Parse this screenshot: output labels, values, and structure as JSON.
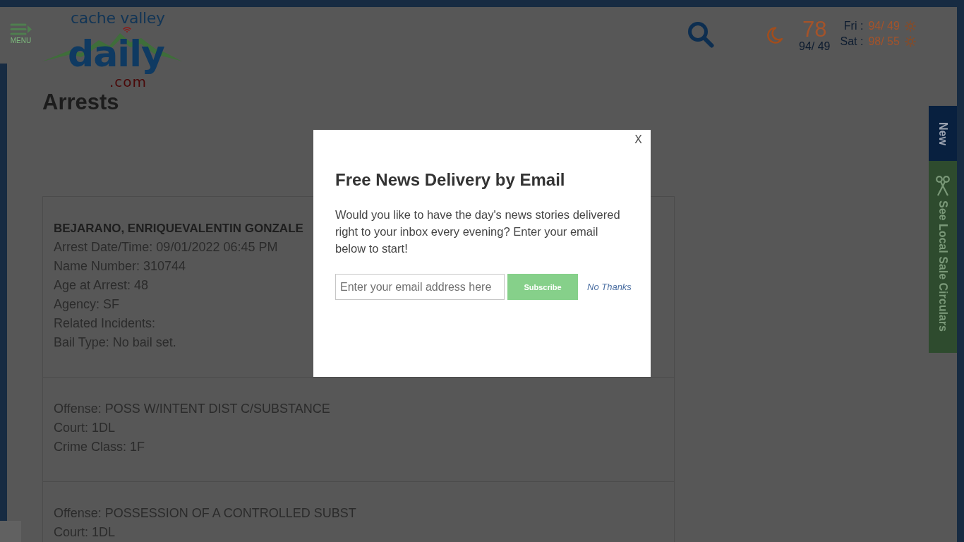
{
  "header": {
    "menu": {
      "label": "MENU"
    },
    "logo": {
      "tagline": "cache valley",
      "wordmark": "daily",
      "domain": ".com"
    },
    "weather": {
      "current_temp": "78",
      "today_range": "94/ 49",
      "forecast": [
        {
          "day": "Fri :",
          "range": "94/ 49"
        },
        {
          "day": "Sat :",
          "range": "98/ 55"
        }
      ]
    }
  },
  "side_tabs": [
    {
      "kind": "new",
      "label": "New"
    },
    {
      "kind": "circulars",
      "label": "See Local Sale Circulars"
    }
  ],
  "page_title": "Arrests",
  "arrest_record": {
    "name": "BEJARANO, ENRIQUEVALENTIN GONZALE",
    "details": [
      "Arrest Date/Time: 09/01/2022 06:45 PM",
      "Name Number: 310744",
      "Age at Arrest: 48",
      "Agency: SF",
      "Related Incidents:",
      "Bail Type: No bail set."
    ],
    "charges": [
      {
        "lines": [
          "Offense: POSS W/INTENT DIST C/SUBSTANCE",
          "Court: 1DL",
          "Crime Class: 1F"
        ]
      },
      {
        "lines": [
          "Offense: POSSESSION OF A CONTROLLED SUBST",
          "Court: 1DL"
        ]
      }
    ]
  },
  "modal": {
    "close": "X",
    "title": "Free News Delivery by Email",
    "message": "Would you like to have the day's news stories delivered right to your inbox every evening? Enter your email below to start!",
    "email_field": {
      "placeholder": "Enter your email address here"
    },
    "subscribe_button": "Subscribe",
    "dismiss_link": "No Thanks"
  }
}
